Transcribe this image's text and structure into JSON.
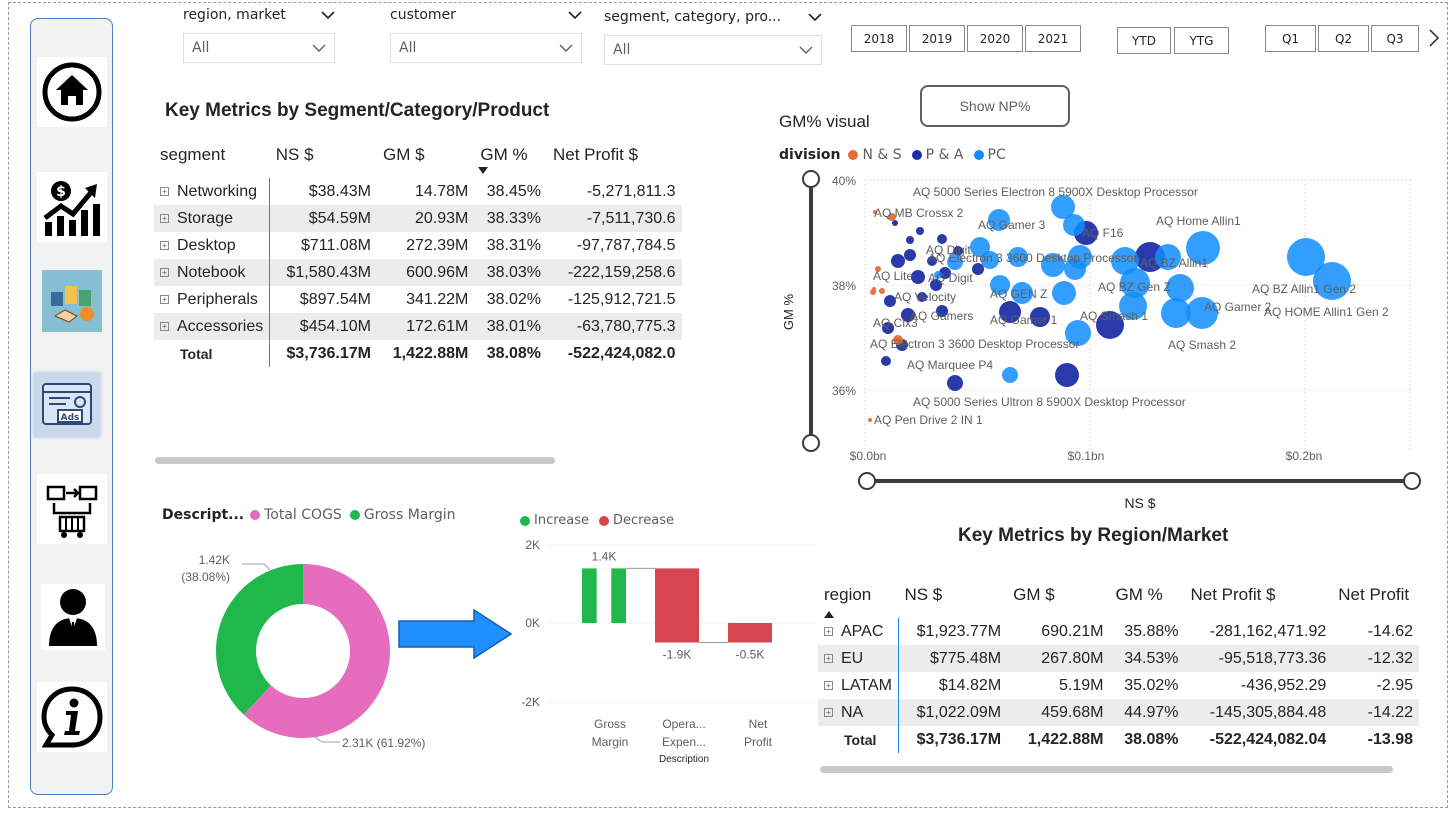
{
  "slicers": [
    {
      "title": "region, market",
      "value": "All"
    },
    {
      "title": "customer",
      "value": "All"
    },
    {
      "title": "segment, category, pro...",
      "value": "All"
    }
  ],
  "years": [
    "2018",
    "2019",
    "2020",
    "2021"
  ],
  "periods": [
    "YTD",
    "YTG"
  ],
  "quarters": [
    "Q1",
    "Q2",
    "Q3"
  ],
  "show_np_label": "Show NP%",
  "nav": [
    "home-icon",
    "finance-chart-icon",
    "supply-deal-icon",
    "ads-icon",
    "supply-chain-icon",
    "user-icon",
    "info-icon"
  ],
  "segment_table": {
    "title": "Key Metrics by Segment/Category/Product",
    "headers": [
      "segment",
      "NS $",
      "GM $",
      "GM %",
      "Net Profit $"
    ],
    "rows": [
      [
        "Networking",
        "$38.43M",
        "14.78M",
        "38.45%",
        "-5,271,811.3"
      ],
      [
        "Storage",
        "$54.59M",
        "20.93M",
        "38.33%",
        "-7,511,730.6"
      ],
      [
        "Desktop",
        "$711.08M",
        "272.39M",
        "38.31%",
        "-97,787,784.5"
      ],
      [
        "Notebook",
        "$1,580.43M",
        "600.96M",
        "38.03%",
        "-222,159,258.6"
      ],
      [
        "Peripherals",
        "$897.54M",
        "341.22M",
        "38.02%",
        "-125,912,721.5"
      ],
      [
        "Accessories",
        "$454.10M",
        "172.61M",
        "38.01%",
        "-63,780,775.3"
      ]
    ],
    "total": [
      "Total",
      "$3,736.17M",
      "1,422.88M",
      "38.08%",
      "-522,424,082.0"
    ]
  },
  "region_table": {
    "title": "Key Metrics by Region/Market",
    "headers": [
      "region",
      "NS $",
      "GM $",
      "GM %",
      "Net Profit $",
      "Net Profit"
    ],
    "rows": [
      [
        "APAC",
        "$1,923.77M",
        "690.21M",
        "35.88%",
        "-281,162,471.92",
        "-14.62"
      ],
      [
        "EU",
        "$775.48M",
        "267.80M",
        "34.53%",
        "-95,518,773.36",
        "-12.32"
      ],
      [
        "LATAM",
        "$14.82M",
        "5.19M",
        "35.02%",
        "-436,952.29",
        "-2.95"
      ],
      [
        "NA",
        "$1,022.09M",
        "459.68M",
        "44.97%",
        "-145,305,884.48",
        "-14.22"
      ]
    ],
    "total": [
      "Total",
      "$3,736.17M",
      "1,422.88M",
      "38.08%",
      "-522,424,082.04",
      "-13.98"
    ]
  },
  "scatter": {
    "title": "GM% visual",
    "legend_title": "division",
    "legend": [
      {
        "name": "N & S",
        "color": "#e66c37"
      },
      {
        "name": "P & A",
        "color": "#1f2fa6"
      },
      {
        "name": "PC",
        "color": "#118dff"
      }
    ],
    "ylabel": "GM %",
    "xlabel": "NS $",
    "yticks": [
      "40%",
      "38%",
      "36%"
    ],
    "xticks": [
      "$0.0bn",
      "$0.1bn",
      "$0.2bn"
    ],
    "labels": [
      "AQ 5000 Series Electron 8 5900X Desktop Processor",
      "AQ MB Crossx 2",
      "AQ Gamer 3",
      "AQ F16",
      "AQ Home Allin1",
      "AQ Digit",
      "AQ Electron 3 3600 Desktop Processor",
      "AQ BZ Allin1",
      "AQ Lite",
      "AQ Digit",
      "AQ GEN Z",
      "AQ BZ Gen Z",
      "AQ BZ Allin1 Gen 2",
      "AQ Velocity",
      "AQ Gamer 2",
      "AQ HOME Allin1 Gen 2",
      "AQ Clx3",
      "AQ Gamers",
      "AQ Gamer 1",
      "AQ Smash 1",
      "AQ Electron 3 3600 Desktop Processor",
      "AQ Smash 2",
      "AQ Marquee P4",
      "AQ 5000 Series Ultron 8 5900X Desktop Processor",
      "AQ Pen Drive 2 IN 1"
    ]
  },
  "donut": {
    "legend_title": "Descript...",
    "legend": [
      {
        "name": "Total COGS",
        "color": "#e66cbd"
      },
      {
        "name": "Gross Margin",
        "color": "#21b84b"
      }
    ],
    "chart_data": {
      "type": "pie",
      "categories": [
        "Total COGS",
        "Gross Margin"
      ],
      "values": [
        2310,
        1420
      ],
      "percent": [
        61.92,
        38.08
      ]
    },
    "label_gm_value": "1.42K",
    "label_gm_pct": "(38.08%)",
    "label_cogs": "2.31K (61.92%)"
  },
  "waterfall": {
    "legend": [
      {
        "name": "Increase",
        "color": "#21b84b"
      },
      {
        "name": "Decrease",
        "color": "#d64550"
      }
    ],
    "yticks": [
      "2K",
      "0K",
      "-2K"
    ],
    "xlabel": "Description",
    "chart_data": {
      "type": "bar",
      "categories": [
        "Gross Margin",
        "Opera... Expen...",
        "Net Profit"
      ],
      "values": [
        1.4,
        -1.9,
        -0.5
      ],
      "labels": [
        "1.4K",
        "-1.9K",
        "-0.5K"
      ],
      "ylim": [
        -2,
        2
      ]
    },
    "cat_lines": [
      [
        "Gross",
        "Margin"
      ],
      [
        "Opera...",
        "Expen..."
      ],
      [
        "Net",
        "Profit"
      ]
    ]
  }
}
